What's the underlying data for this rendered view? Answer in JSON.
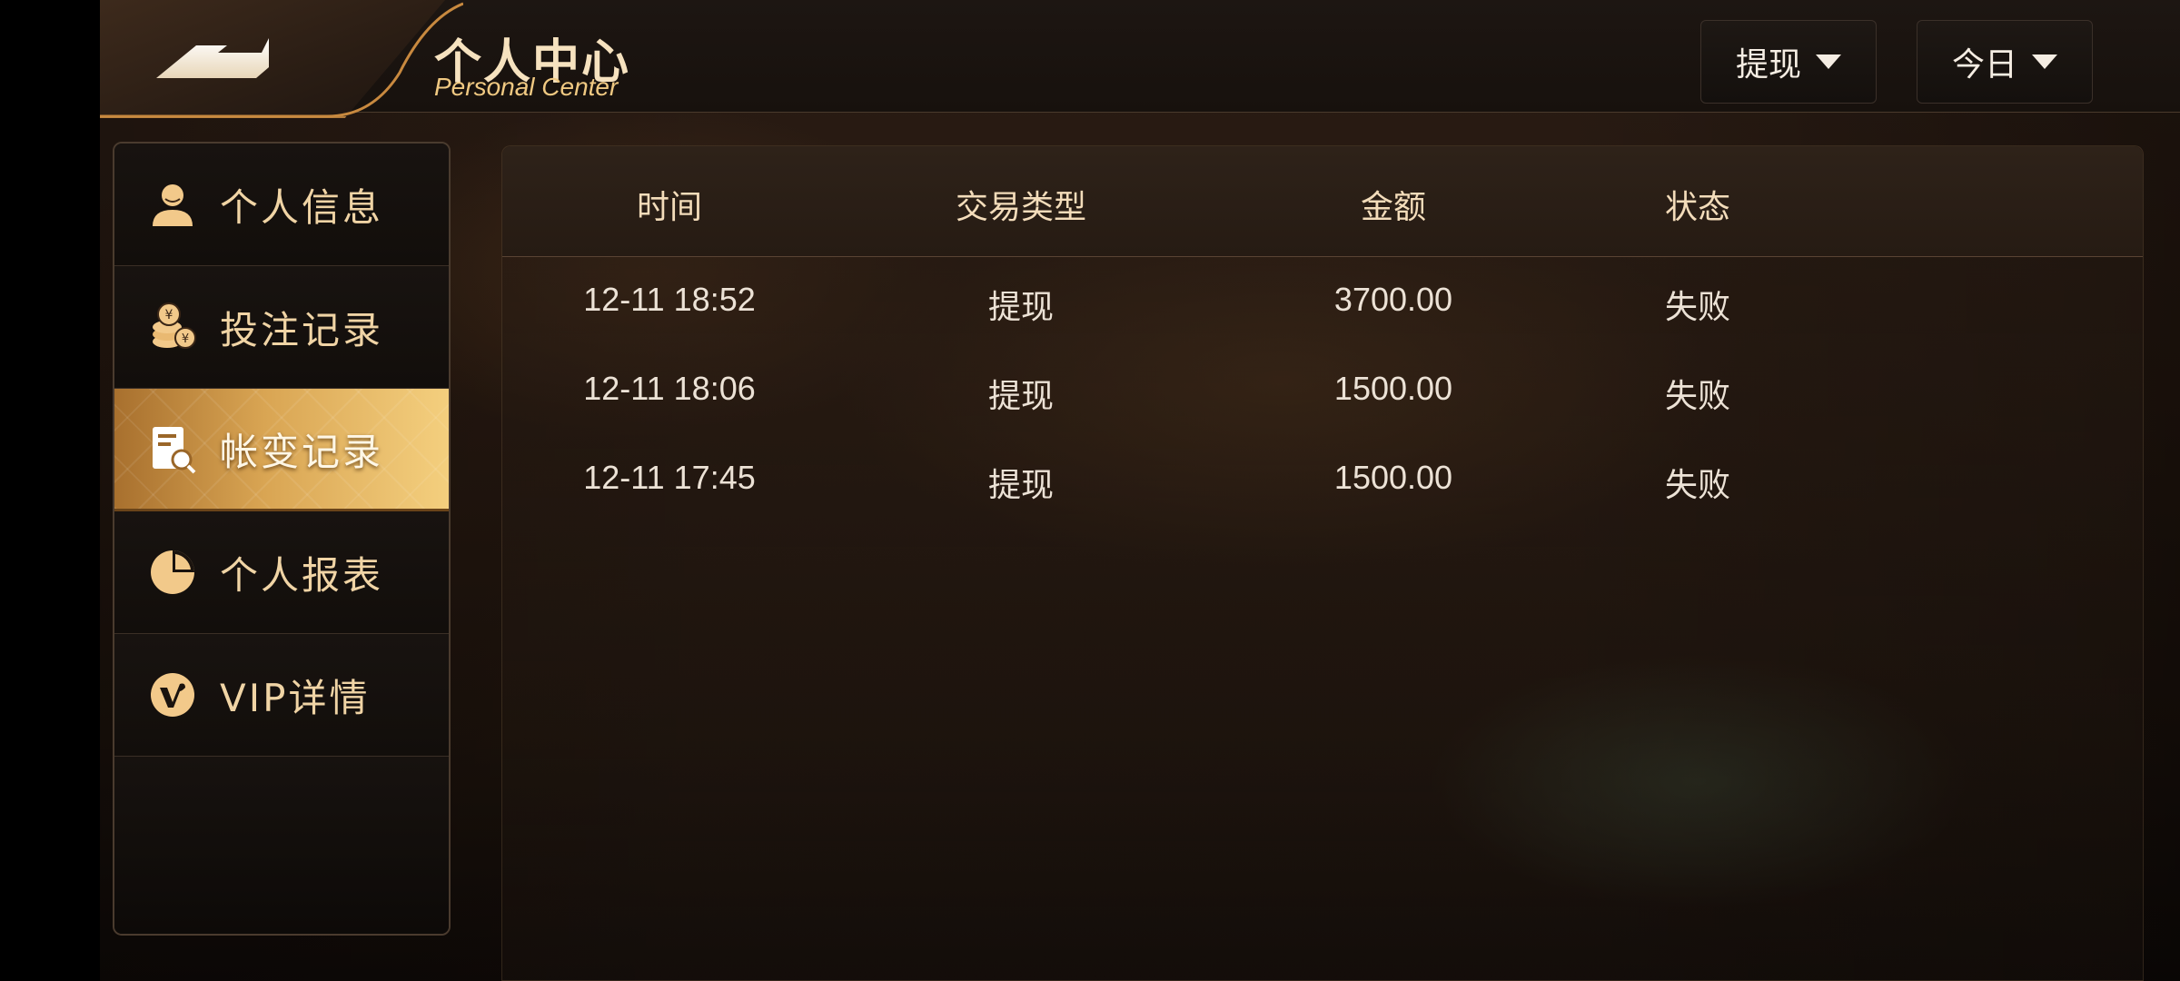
{
  "header": {
    "title_cn": "个人中心",
    "title_en": "Personal Center",
    "back_icon": "back-arrow-icon",
    "filters": {
      "type_selected": "提现",
      "date_selected": "今日"
    }
  },
  "sidebar": {
    "items": [
      {
        "label": "个人信息",
        "icon": "user-icon",
        "active": false
      },
      {
        "label": "投注记录",
        "icon": "coins-icon",
        "active": false
      },
      {
        "label": "帐变记录",
        "icon": "search-document-icon",
        "active": true
      },
      {
        "label": "个人报表",
        "icon": "pie-chart-icon",
        "active": false
      },
      {
        "label": "VIP详情",
        "icon": "vip-badge-icon",
        "active": false
      }
    ]
  },
  "table": {
    "columns": [
      "时间",
      "交易类型",
      "金额",
      "状态"
    ],
    "rows": [
      {
        "time": "12-11 18:52",
        "type": "提现",
        "amount": "3700.00",
        "status": "失败"
      },
      {
        "time": "12-11 18:06",
        "type": "提现",
        "amount": "1500.00",
        "status": "失败"
      },
      {
        "time": "12-11 17:45",
        "type": "提现",
        "amount": "1500.00",
        "status": "失败"
      }
    ]
  },
  "colors": {
    "accent_gold": "#d9a553",
    "text_gold": "#f0d4a5",
    "text_light": "#ece2d6"
  }
}
